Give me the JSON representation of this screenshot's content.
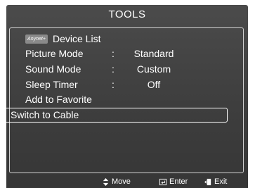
{
  "title": "TOOLS",
  "menu": [
    {
      "label": "Device List",
      "badge": "Anynet+"
    },
    {
      "label": "Picture Mode",
      "colon": ":",
      "value": "Standard"
    },
    {
      "label": "Sound Mode",
      "colon": ":",
      "value": "Custom"
    },
    {
      "label": "Sleep Timer",
      "colon": ":",
      "value": "Off"
    },
    {
      "label": "Add to Favorite"
    },
    {
      "label": "Switch to Cable"
    }
  ],
  "footer": {
    "move": {
      "icon": "up-down-arrows-icon",
      "label": "Move"
    },
    "enter": {
      "icon": "enter-icon",
      "label": "Enter"
    },
    "exit": {
      "icon": "exit-icon",
      "label": "Exit"
    }
  },
  "colors": {
    "panel": "#444444",
    "text": "#ffffff",
    "frame": "#d0d0d0"
  }
}
